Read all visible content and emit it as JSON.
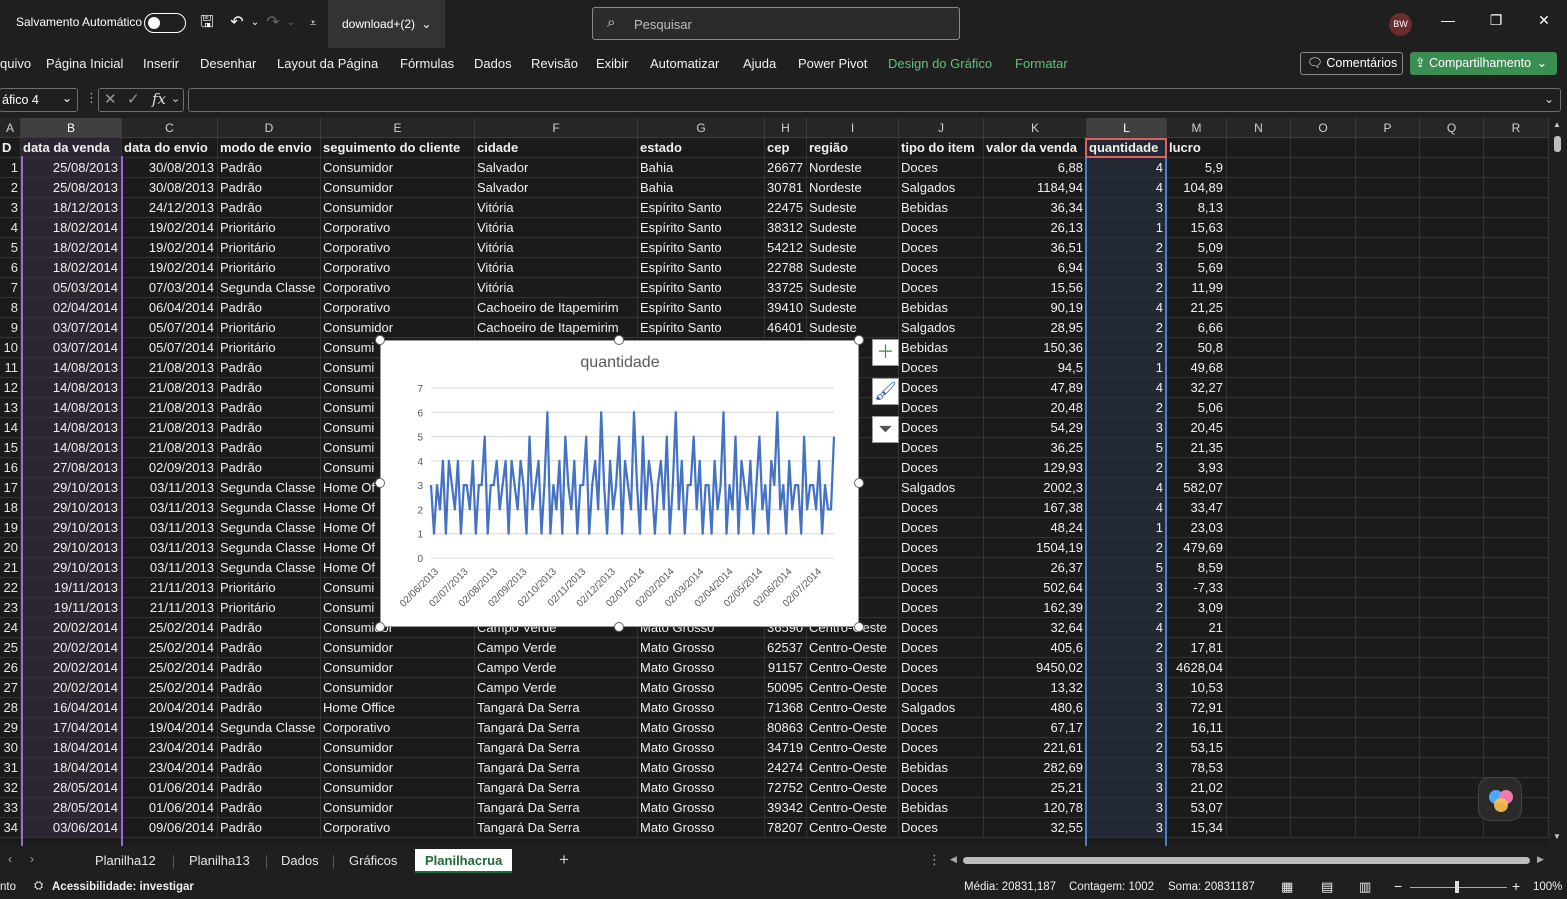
{
  "titlebar": {
    "autosave_label": "Salvamento Automático",
    "file_name": "download+(2)",
    "search_placeholder": "Pesquisar",
    "avatar_initials": "BW"
  },
  "ribbon": {
    "tabs": [
      "quivo",
      "Página Inicial",
      "Inserir",
      "Desenhar",
      "Layout da Página",
      "Fórmulas",
      "Dados",
      "Revisão",
      "Exibir",
      "Automatizar",
      "Ajuda",
      "Power Pivot",
      "Design do Gráfico",
      "Formatar"
    ],
    "comments_label": "Comentários",
    "share_label": "Compartilhamento"
  },
  "formula_bar": {
    "name_box": "áfico 4",
    "fx": "fx"
  },
  "columns": [
    "A",
    "B",
    "C",
    "D",
    "E",
    "F",
    "G",
    "H",
    "I",
    "J",
    "K",
    "L",
    "M",
    "N",
    "O",
    "P",
    "Q",
    "R"
  ],
  "headers": [
    "D",
    "data da venda",
    "data do envio",
    "modo de envio",
    "seguimento do cliente",
    "cidade",
    "estado",
    "cep",
    "região",
    "tipo do item",
    "valor da venda",
    "quantidade",
    "lucro"
  ],
  "rows": [
    [
      "1",
      "25/08/2013",
      "30/08/2013",
      "Padrão",
      "Consumidor",
      "Salvador",
      "Bahia",
      "26677",
      "Nordeste",
      "Doces",
      "6,88",
      "4",
      "5,9"
    ],
    [
      "2",
      "25/08/2013",
      "30/08/2013",
      "Padrão",
      "Consumidor",
      "Salvador",
      "Bahia",
      "30781",
      "Nordeste",
      "Salgados",
      "1184,94",
      "4",
      "104,89"
    ],
    [
      "3",
      "18/12/2013",
      "24/12/2013",
      "Padrão",
      "Consumidor",
      "Vitória",
      "Espírito Santo",
      "22475",
      "Sudeste",
      "Bebidas",
      "36,34",
      "3",
      "8,13"
    ],
    [
      "4",
      "18/02/2014",
      "19/02/2014",
      "Prioritário",
      "Corporativo",
      "Vitória",
      "Espírito Santo",
      "38312",
      "Sudeste",
      "Doces",
      "26,13",
      "1",
      "15,63"
    ],
    [
      "5",
      "18/02/2014",
      "19/02/2014",
      "Prioritário",
      "Corporativo",
      "Vitória",
      "Espírito Santo",
      "54212",
      "Sudeste",
      "Doces",
      "36,51",
      "2",
      "5,09"
    ],
    [
      "6",
      "18/02/2014",
      "19/02/2014",
      "Prioritário",
      "Corporativo",
      "Vitória",
      "Espírito Santo",
      "22788",
      "Sudeste",
      "Doces",
      "6,94",
      "3",
      "5,69"
    ],
    [
      "7",
      "05/03/2014",
      "07/03/2014",
      "Segunda Classe",
      "Corporativo",
      "Vitória",
      "Espírito Santo",
      "33725",
      "Sudeste",
      "Doces",
      "15,56",
      "2",
      "11,99"
    ],
    [
      "8",
      "02/04/2014",
      "06/04/2014",
      "Padrão",
      "Corporativo",
      "Cachoeiro de Itapemirim",
      "Espírito Santo",
      "39410",
      "Sudeste",
      "Bebidas",
      "90,19",
      "4",
      "21,25"
    ],
    [
      "9",
      "03/07/2014",
      "05/07/2014",
      "Prioritário",
      "Consumidor",
      "Cachoeiro de Itapemirim",
      "Espírito Santo",
      "46401",
      "Sudeste",
      "Salgados",
      "28,95",
      "2",
      "6,66"
    ],
    [
      "10",
      "03/07/2014",
      "05/07/2014",
      "Prioritário",
      "Consumi",
      "",
      "",
      "",
      "",
      "Bebidas",
      "150,36",
      "2",
      "50,8"
    ],
    [
      "11",
      "14/08/2013",
      "21/08/2013",
      "Padrão",
      "Consumi",
      "",
      "",
      "",
      "Deste",
      "Doces",
      "94,5",
      "1",
      "49,68"
    ],
    [
      "12",
      "14/08/2013",
      "21/08/2013",
      "Padrão",
      "Consumi",
      "",
      "",
      "",
      "Deste",
      "Doces",
      "47,89",
      "4",
      "32,27"
    ],
    [
      "13",
      "14/08/2013",
      "21/08/2013",
      "Padrão",
      "Consumi",
      "",
      "",
      "",
      "Deste",
      "Doces",
      "20,48",
      "2",
      "5,06"
    ],
    [
      "14",
      "14/08/2013",
      "21/08/2013",
      "Padrão",
      "Consumi",
      "",
      "",
      "",
      "De",
      "Doces",
      "54,29",
      "3",
      "20,45"
    ],
    [
      "15",
      "14/08/2013",
      "21/08/2013",
      "Padrão",
      "Consumi",
      "",
      "",
      "",
      "Deste",
      "Doces",
      "36,25",
      "5",
      "21,35"
    ],
    [
      "16",
      "27/08/2013",
      "02/09/2013",
      "Padrão",
      "Consumi",
      "",
      "",
      "",
      "Deste",
      "Doces",
      "129,93",
      "2",
      "3,93"
    ],
    [
      "17",
      "29/10/2013",
      "03/11/2013",
      "Segunda Classe",
      "Home Of",
      "",
      "",
      "",
      "Deste",
      "Salgados",
      "2002,3",
      "4",
      "582,07"
    ],
    [
      "18",
      "29/10/2013",
      "03/11/2013",
      "Segunda Classe",
      "Home Of",
      "",
      "",
      "",
      "Deste",
      "Doces",
      "167,38",
      "4",
      "33,47"
    ],
    [
      "19",
      "29/10/2013",
      "03/11/2013",
      "Segunda Classe",
      "Home Of",
      "",
      "",
      "",
      "Deste",
      "Doces",
      "48,24",
      "1",
      "23,03"
    ],
    [
      "20",
      "29/10/2013",
      "03/11/2013",
      "Segunda Classe",
      "Home Of",
      "",
      "",
      "",
      "Deste",
      "Doces",
      "1504,19",
      "2",
      "479,69"
    ],
    [
      "21",
      "29/10/2013",
      "03/11/2013",
      "Segunda Classe",
      "Home Of",
      "",
      "",
      "",
      "Deste",
      "Doces",
      "26,37",
      "5",
      "8,59"
    ],
    [
      "22",
      "19/11/2013",
      "21/11/2013",
      "Prioritário",
      "Consumi",
      "",
      "",
      "",
      "Deste",
      "Doces",
      "502,64",
      "3",
      "-7,33"
    ],
    [
      "23",
      "19/11/2013",
      "21/11/2013",
      "Prioritário",
      "Consumi",
      "",
      "",
      "",
      "Deste",
      "Doces",
      "162,39",
      "2",
      "3,09"
    ],
    [
      "24",
      "20/02/2014",
      "25/02/2014",
      "Padrão",
      "Consumidor",
      "Campo Verde",
      "Mato Grosso",
      "36590",
      "Centro-Oeste",
      "Doces",
      "32,64",
      "4",
      "21"
    ],
    [
      "25",
      "20/02/2014",
      "25/02/2014",
      "Padrão",
      "Consumidor",
      "Campo Verde",
      "Mato Grosso",
      "62537",
      "Centro-Oeste",
      "Doces",
      "405,6",
      "2",
      "17,81"
    ],
    [
      "26",
      "20/02/2014",
      "25/02/2014",
      "Padrão",
      "Consumidor",
      "Campo Verde",
      "Mato Grosso",
      "91157",
      "Centro-Oeste",
      "Doces",
      "9450,02",
      "3",
      "4628,04"
    ],
    [
      "27",
      "20/02/2014",
      "25/02/2014",
      "Padrão",
      "Consumidor",
      "Campo Verde",
      "Mato Grosso",
      "50095",
      "Centro-Oeste",
      "Doces",
      "13,32",
      "3",
      "10,53"
    ],
    [
      "28",
      "16/04/2014",
      "20/04/2014",
      "Padrão",
      "Home Office",
      "Tangará Da Serra",
      "Mato Grosso",
      "71368",
      "Centro-Oeste",
      "Salgados",
      "480,6",
      "3",
      "72,91"
    ],
    [
      "29",
      "17/04/2014",
      "19/04/2014",
      "Segunda Classe",
      "Corporativo",
      "Tangará Da Serra",
      "Mato Grosso",
      "80863",
      "Centro-Oeste",
      "Doces",
      "67,17",
      "2",
      "16,11"
    ],
    [
      "30",
      "18/04/2014",
      "23/04/2014",
      "Padrão",
      "Consumidor",
      "Tangará Da Serra",
      "Mato Grosso",
      "34719",
      "Centro-Oeste",
      "Doces",
      "221,61",
      "2",
      "53,15"
    ],
    [
      "31",
      "18/04/2014",
      "23/04/2014",
      "Padrão",
      "Consumidor",
      "Tangará Da Serra",
      "Mato Grosso",
      "24274",
      "Centro-Oeste",
      "Bebidas",
      "282,69",
      "3",
      "78,53"
    ],
    [
      "32",
      "28/05/2014",
      "01/06/2014",
      "Padrão",
      "Consumidor",
      "Tangará Da Serra",
      "Mato Grosso",
      "72752",
      "Centro-Oeste",
      "Doces",
      "25,21",
      "3",
      "21,02"
    ],
    [
      "33",
      "28/05/2014",
      "01/06/2014",
      "Padrão",
      "Consumidor",
      "Tangará Da Serra",
      "Mato Grosso",
      "39342",
      "Centro-Oeste",
      "Bebidas",
      "120,78",
      "3",
      "53,07"
    ],
    [
      "34",
      "03/06/2014",
      "09/06/2014",
      "Padrão",
      "Corporativo",
      "Tangará Da Serra",
      "Mato Grosso",
      "78207",
      "Centro-Oeste",
      "Doces",
      "32,55",
      "3",
      "15,34"
    ]
  ],
  "chart_data": {
    "type": "line",
    "title": "quantidade",
    "color": "#4472c4",
    "ylim": [
      0,
      7
    ],
    "yticks": [
      0,
      1,
      2,
      3,
      4,
      5,
      6,
      7
    ],
    "categories": [
      "02/06/2013",
      "02/07/2013",
      "02/08/2013",
      "02/09/2013",
      "02/10/2013",
      "02/11/2013",
      "02/12/2013",
      "02/01/2014",
      "02/02/2014",
      "02/03/2014",
      "02/04/2014",
      "02/05/2014",
      "02/06/2014",
      "02/07/2014"
    ],
    "values": [
      3,
      1,
      3,
      2,
      4,
      1,
      4,
      3,
      2,
      4,
      1,
      3,
      3,
      2,
      4,
      1,
      3,
      3,
      5,
      1,
      3,
      3,
      4,
      2,
      3,
      4,
      1,
      4,
      3,
      2,
      4,
      3,
      1,
      5,
      2,
      3,
      4,
      1,
      3,
      6,
      1,
      3,
      2,
      4,
      1,
      5,
      3,
      2,
      4,
      1,
      3,
      3,
      5,
      1,
      3,
      4,
      2,
      6,
      3,
      1,
      4,
      2,
      3,
      5,
      1,
      4,
      3,
      2,
      6,
      3,
      1,
      5,
      2,
      4,
      3,
      1,
      3,
      4,
      2,
      5,
      1,
      3,
      6,
      2,
      4,
      1,
      3,
      3,
      5,
      2,
      4,
      1,
      3,
      3,
      1,
      4,
      2,
      3,
      6,
      1,
      3,
      2,
      5,
      1,
      4,
      3,
      2,
      4,
      1,
      3,
      5,
      2,
      3,
      1,
      4,
      3,
      6,
      2,
      3,
      1,
      4,
      2,
      3,
      3,
      1,
      5,
      2,
      3,
      3,
      2,
      4,
      1,
      3,
      2,
      2,
      5
    ]
  },
  "sheets": [
    "Planilha12",
    "Planilha13",
    "Dados",
    "Gráficos",
    "Planilhacrua"
  ],
  "active_sheet": "Planilhacrua",
  "status": {
    "left": "nto",
    "accessibility": "Acessibilidade: investigar",
    "media": "Média: 20831,187",
    "contagem": "Contagem: 1002",
    "soma": "Soma: 20831187",
    "zoom": "100%"
  }
}
